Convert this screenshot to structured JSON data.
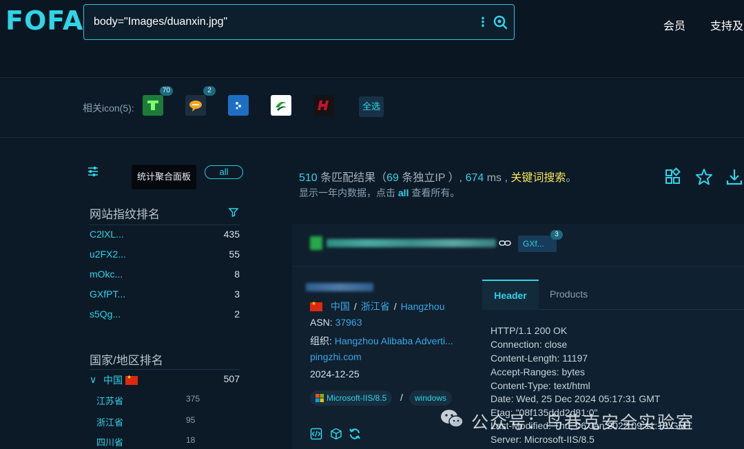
{
  "header": {
    "logo_text": "FOFA",
    "search_query": "body=\"Images/duanxin.jpg\"",
    "nav": [
      "会员",
      "支持及"
    ]
  },
  "icon_filter": {
    "label": "相关icon(5):",
    "icons": [
      {
        "name": "green-icon",
        "badge": "70",
        "color": "#2aa84a"
      },
      {
        "name": "chat-bubble-icon",
        "badge": "2",
        "color": "#f0a420"
      },
      {
        "name": "blue-dots-icon",
        "badge": "",
        "color": "#2e86de"
      },
      {
        "name": "green-swirl-icon",
        "badge": "",
        "color": "#1a9e3c"
      },
      {
        "name": "red-logo-icon",
        "badge": "",
        "color": "#c8102e"
      }
    ],
    "select_all_label": "全选"
  },
  "sidebar": {
    "tooltip": "统计聚合面板",
    "all_label": "all",
    "fingerprint_title": "网站指纹排名",
    "fingerprints": [
      {
        "name": "C2lXL...",
        "count": "435"
      },
      {
        "name": "u2FX2...",
        "count": "55"
      },
      {
        "name": "mOkc...",
        "count": "8"
      },
      {
        "name": "GXfPT...",
        "count": "3"
      },
      {
        "name": "s5Qg...",
        "count": "2"
      }
    ],
    "country_title": "国家/地区排名",
    "country": {
      "name": "中国",
      "count": "507"
    },
    "provinces": [
      {
        "name": "江苏省",
        "count": "375"
      },
      {
        "name": "浙江省",
        "count": "95"
      },
      {
        "name": "四川省",
        "count": "18"
      }
    ]
  },
  "results": {
    "count": "510",
    "count_text": " 条匹配结果（",
    "ip_count": "69",
    "ip_text": " 条独立IP ）,",
    "ms": "674",
    "ms_text": " ms ,",
    "keyword_link": "关键词搜索",
    "period": "。",
    "sub_pre": "显示一年内数据，点击",
    "sub_all": "all",
    "sub_post": "查看所有。"
  },
  "card": {
    "tag_label": "GXf...",
    "tag_badge": "3",
    "location": {
      "country": "中国",
      "province": "浙江省",
      "city": "Hangzhou"
    },
    "asn_label": "ASN:",
    "asn": "37963",
    "org_label": "组织:",
    "org": "Hangzhou Alibaba Adverti...",
    "domain": "pingzhi.com",
    "date": "2024-12-25",
    "server_tag": "Microsoft-IIS/8.5",
    "os_tag": "windows",
    "tabs": [
      "Header",
      "Products"
    ],
    "header_lines": [
      "HTTP/1.1 200 OK",
      "Connection: close",
      "Content-Length: 11197",
      "Accept-Ranges: bytes",
      "Content-Type: text/html",
      "Date: Wed, 25 Dec 2024 05:17:31 GMT",
      "Etag: \"08f135ddd2d81:0\"",
      "Last-Modified: Thu, 06 Jan 2022 09:11:18 GMT",
      "Server: Microsoft-IIS/8.5"
    ]
  },
  "watermark": "公众号：鸟巷克安全实验室",
  "colors": {
    "accent": "#2fd4e7",
    "link": "#3aa8e8",
    "keyword": "#f6e35a",
    "background": "#0c1a27"
  }
}
